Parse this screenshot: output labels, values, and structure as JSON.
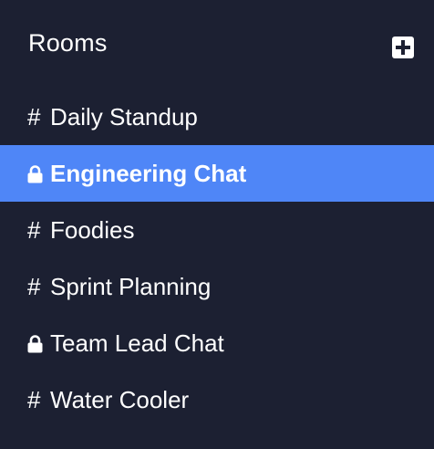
{
  "sidebar": {
    "title": "Rooms",
    "add_icon": "plus-square-icon",
    "rooms": [
      {
        "prefix": "#",
        "icon": "hash-icon",
        "name": "Daily Standup",
        "private": false,
        "active": false
      },
      {
        "prefix": "",
        "icon": "lock-icon",
        "name": "Engineering Chat",
        "private": true,
        "active": true
      },
      {
        "prefix": "#",
        "icon": "hash-icon",
        "name": "Foodies",
        "private": false,
        "active": false
      },
      {
        "prefix": "#",
        "icon": "hash-icon",
        "name": "Sprint Planning",
        "private": false,
        "active": false
      },
      {
        "prefix": "",
        "icon": "lock-icon",
        "name": "Team Lead Chat",
        "private": true,
        "active": false
      },
      {
        "prefix": "#",
        "icon": "hash-icon",
        "name": "Water Cooler",
        "private": false,
        "active": false
      }
    ]
  },
  "colors": {
    "background": "#1c2032",
    "active": "#4f86f7",
    "text": "#ffffff"
  }
}
